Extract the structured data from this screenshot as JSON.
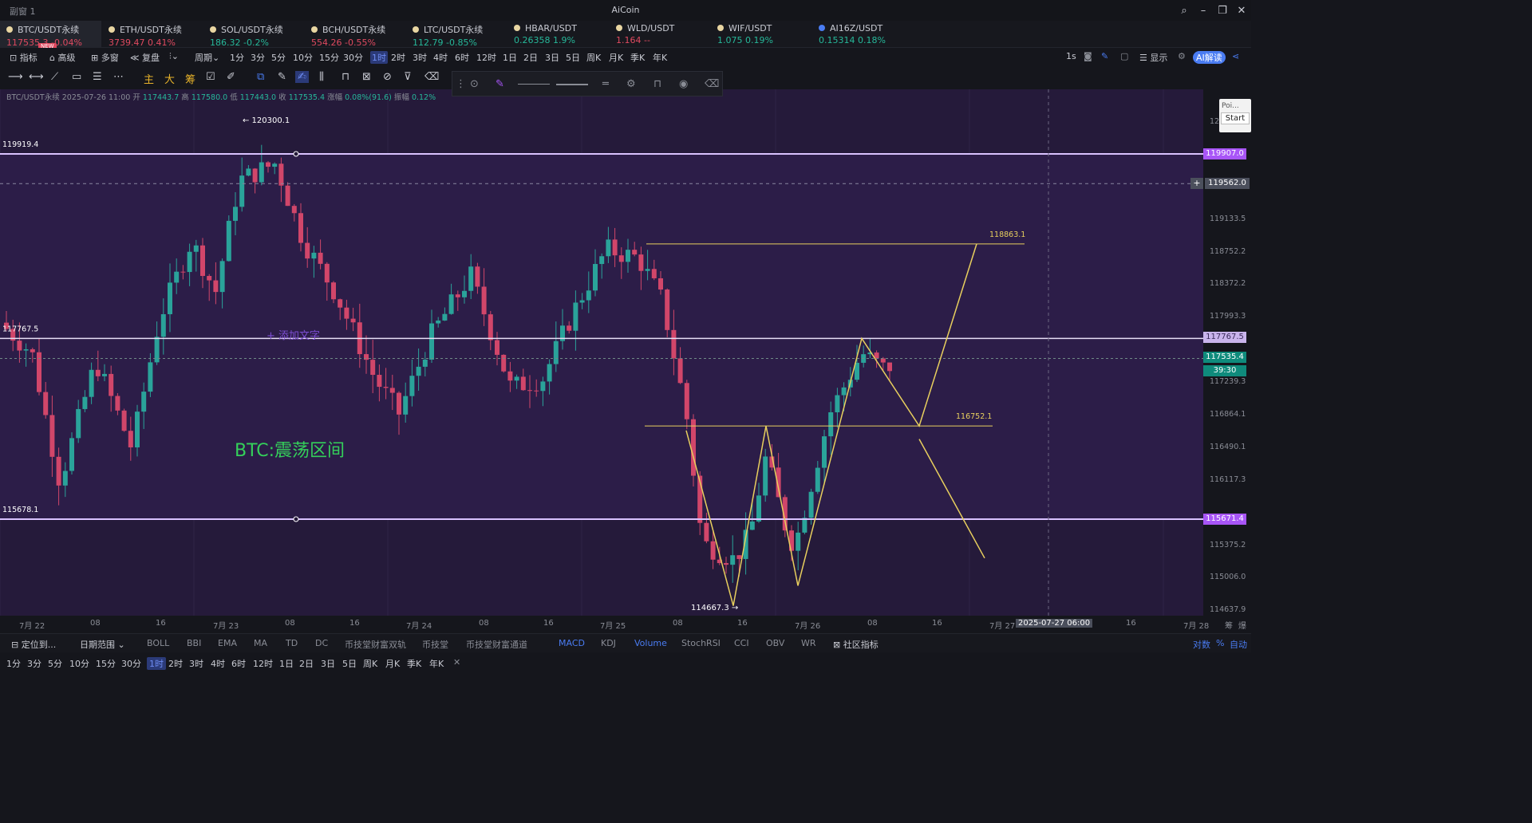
{
  "window": {
    "subtitle": "副窗 1",
    "app_title": "AiCoin"
  },
  "tickers": [
    {
      "name": "BTC/USDT永续",
      "price": "117535.3",
      "change": "-0.04%",
      "dir": "down",
      "badge": "NEW"
    },
    {
      "name": "ETH/USDT永续",
      "price": "3739.47",
      "change": "0.41%",
      "dir": "down"
    },
    {
      "name": "SOL/USDT永续",
      "price": "186.32",
      "change": "-0.2%",
      "dir": "up"
    },
    {
      "name": "BCH/USDT永续",
      "price": "554.26",
      "change": "-0.55%",
      "dir": "down"
    },
    {
      "name": "LTC/USDT永续",
      "price": "112.79",
      "change": "-0.85%",
      "dir": "up"
    },
    {
      "name": "HBAR/USDT",
      "price": "0.26358",
      "change": "1.9%",
      "dir": "up"
    },
    {
      "name": "WLD/USDT",
      "price": "1.164",
      "change": "--",
      "dir": "down"
    },
    {
      "name": "WIF/USDT",
      "price": "1.075",
      "change": "0.19%",
      "dir": "up"
    },
    {
      "name": "AI16Z/USDT",
      "price": "0.15314",
      "change": "0.18%",
      "dir": "up"
    }
  ],
  "toolbar": {
    "indicator": "指标",
    "advanced": "高级",
    "multi": "多窗",
    "adjust": "复盘",
    "period": "周期",
    "periods": [
      "1分",
      "3分",
      "5分",
      "10分",
      "15分",
      "30分",
      "1时",
      "2时",
      "3时",
      "4时",
      "6时",
      "12时",
      "1日",
      "2日",
      "3日",
      "5日",
      "周K",
      "月K",
      "季K",
      "年K"
    ],
    "selected_period": "1时",
    "interval": "1s",
    "display": "显示",
    "ai": "AI解读"
  },
  "draw_tools": [
    "主",
    "大",
    "筹"
  ],
  "ohlc": {
    "symbol": "BTC/USDT永续",
    "time": "2025-07-26 11:00",
    "open_label": "开",
    "open": "117443.7",
    "high_label": "高",
    "high": "117580.0",
    "low_label": "低",
    "low": "117443.0",
    "close_label": "收",
    "close": "117535.4",
    "chg_label": "涨幅",
    "chg": "0.08%(91.6)",
    "amp_label": "振幅",
    "amp": "0.12%"
  },
  "chart": {
    "annotation": "BTC:震荡区间",
    "add_text": "添加文字",
    "high_marker": "120300.1",
    "low_marker": "114667.3",
    "left_labels": {
      "top": "119919.4",
      "mid": "117767.5",
      "bottom": "115678.1"
    },
    "target_labels": {
      "upper": "118863.1",
      "middle": "116752.1"
    },
    "price_axis": [
      "119133.5",
      "118752.2",
      "118372.2",
      "117993.3",
      "117239.3",
      "116864.1",
      "116490.1",
      "116117.3",
      "115375.2",
      "115006.0",
      "114637.9"
    ],
    "price_tags": {
      "top": "119907.0",
      "cross": "119562.0",
      "mid": "117767.5",
      "last": "117535.4",
      "countdown": "39:30",
      "bottom": "115671.4"
    },
    "axis_partial": "12",
    "time_axis": [
      "7月 22",
      "08",
      "16",
      "7月 23",
      "08",
      "16",
      "7月 24",
      "08",
      "16",
      "7月 25",
      "08",
      "16",
      "7月 26",
      "08",
      "16",
      "7月 27",
      "16",
      "7月 28"
    ],
    "time_crosshair": "2025-07-27 06:00",
    "axis_icons": [
      "筹",
      "爆"
    ]
  },
  "popup": {
    "text": "Poi...",
    "button": "Start"
  },
  "bottom": {
    "locate": "定位到...",
    "range": "日期范围",
    "indicators": [
      "BOLL",
      "BBI",
      "EMA",
      "MA",
      "TD",
      "DC",
      "币技堂财富双轨",
      "币技堂",
      "币技堂财富通道"
    ],
    "sub_indicators": [
      "MACD",
      "KDJ",
      "Volume",
      "StochRSI",
      "CCI",
      "OBV",
      "WR"
    ],
    "community": "社区指标",
    "scale": "对数",
    "pct": "%",
    "auto": "自动"
  }
}
